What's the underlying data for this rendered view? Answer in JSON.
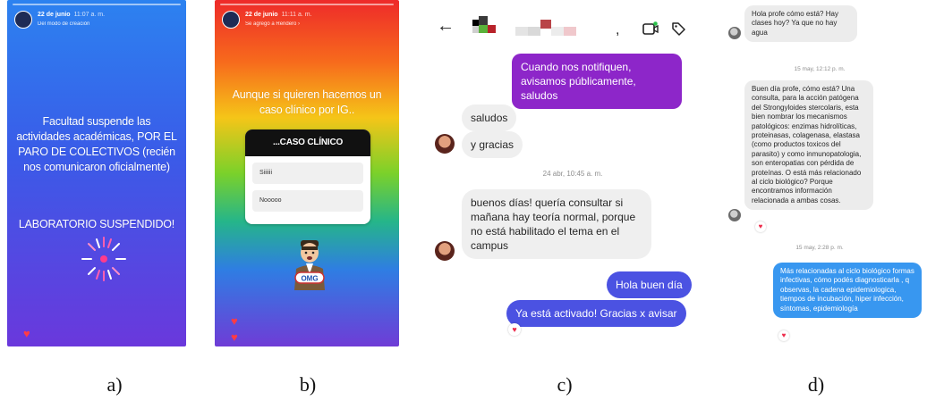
{
  "captions": [
    "a)",
    "b)",
    "c)",
    "d)"
  ],
  "panel_a": {
    "header_name": "22 de junio",
    "header_time": "11:07 a. m.",
    "header_sub": "Del modo de creación",
    "text_main": "Facultad suspende las actividades académicas, POR EL PARO DE COLECTIVOS (recién nos comunicaron oficialmente)",
    "text_second": "LABORATORIO SUSPENDIDO!"
  },
  "panel_b": {
    "header_name": "22 de junio",
    "header_time": "11:11 a. m.",
    "header_sub": "Se agregó a Rendero ›",
    "text_main": "Aunque si quieren hacemos un caso clínico por IG..",
    "quiz_title": "...CASO CLÍNICO",
    "quiz_options": [
      "Siiiiii",
      "Nooooo"
    ]
  },
  "panel_c": {
    "title_comma": ",",
    "msg_sent_1": "Cuando nos notifiquen, avisamos públicamente, saludos",
    "msg_recv_1": "saludos",
    "msg_recv_2": "y gracias",
    "timestamp": "24 abr, 10:45 a. m.",
    "msg_recv_3": "buenos días! quería consultar si mañana hay teoría normal, porque no está habilitado el tema en el campus",
    "msg_sent_2": "Hola buen día",
    "msg_sent_3": "Ya está activado! Gracias x avisar"
  },
  "panel_d": {
    "msg_recv_1": "Hola profe cómo está? Hay clases hoy? Ya que no hay agua",
    "timestamp_1": "15 may, 12:12 p. m.",
    "msg_recv_2": "Buen día profe, cómo está? Una consulta, para la acción patógena del Strongyloides stercolaris, esta bien nombrar los mecanismos patológicos: enzimas hidrolíticas, proteinasas, colagenasa, elastasa (como productos toxicos del parasito) y como inmunopatologia, son enteropatias con pérdida de proteínas. O está más relacionado al ciclo biológico? Porque encontramos información relacionada a ambas cosas.",
    "timestamp_2": "15 may, 2:28 p. m.",
    "msg_sent_1": "Más relacionadas al ciclo biológico formas infectivas, cómo podés diagnosticarla , q observas, la cadena epidemiologica, tiempos de incubación, hiper infección, síntomas, epidemiología"
  },
  "colors": {
    "sent_purple": "#8d26c9",
    "sent_blue": "#4b52e2",
    "sent_blue_d": "#3897f0",
    "received_gray": "#efefef",
    "heart": "#ed2a4a"
  },
  "icons": [
    "back-arrow-icon",
    "video-call-icon",
    "tag-icon",
    "heart-icon",
    "firework-icon",
    "omg-sticker-icon"
  ]
}
